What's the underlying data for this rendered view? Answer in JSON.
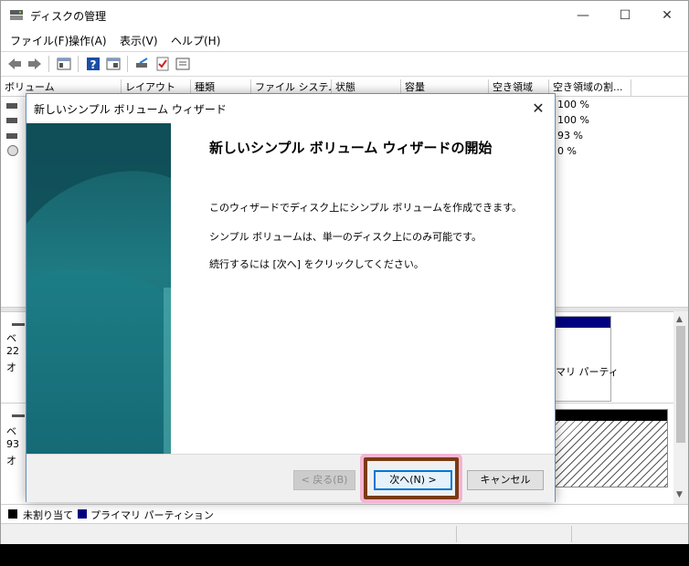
{
  "window": {
    "title": "ディスクの管理"
  },
  "menu": [
    "ファイル(F)",
    "操作(A)",
    "表示(V)",
    "ヘルプ(H)"
  ],
  "columns": [
    "ボリューム",
    "レイアウト",
    "種類",
    "ファイル システム",
    "状態",
    "容量",
    "空き領域",
    "空き領域の割..."
  ],
  "volume_rows_pct": [
    "100 %",
    "100 %",
    "93 %",
    "0 %"
  ],
  "disk_labels": [
    {
      "l1": "ベ",
      "l2": "22",
      "l3": "オ"
    },
    {
      "l1": "ベ",
      "l2": "93",
      "l3": "オ"
    }
  ],
  "partition_label": "マリ パーティ",
  "legend": {
    "unallocated": "未割り当て",
    "primary": "プライマリ パーティション"
  },
  "colors": {
    "accent": "#0078d7",
    "primary_partition": "#000080",
    "highlight_border": "#7a3a14",
    "banner": "#1e6f78"
  },
  "dialog": {
    "title": "新しいシンプル ボリューム ウィザード",
    "heading": "新しいシンプル ボリューム ウィザードの開始",
    "paragraphs": [
      "このウィザードでディスク上にシンプル ボリュームを作成できます。",
      "シンプル ボリュームは、単一のディスク上にのみ可能です。",
      "続行するには [次へ] をクリックしてください。"
    ],
    "back_label": "< 戻る(B)",
    "next_label": "次へ(N) >",
    "cancel_label": "キャンセル"
  }
}
